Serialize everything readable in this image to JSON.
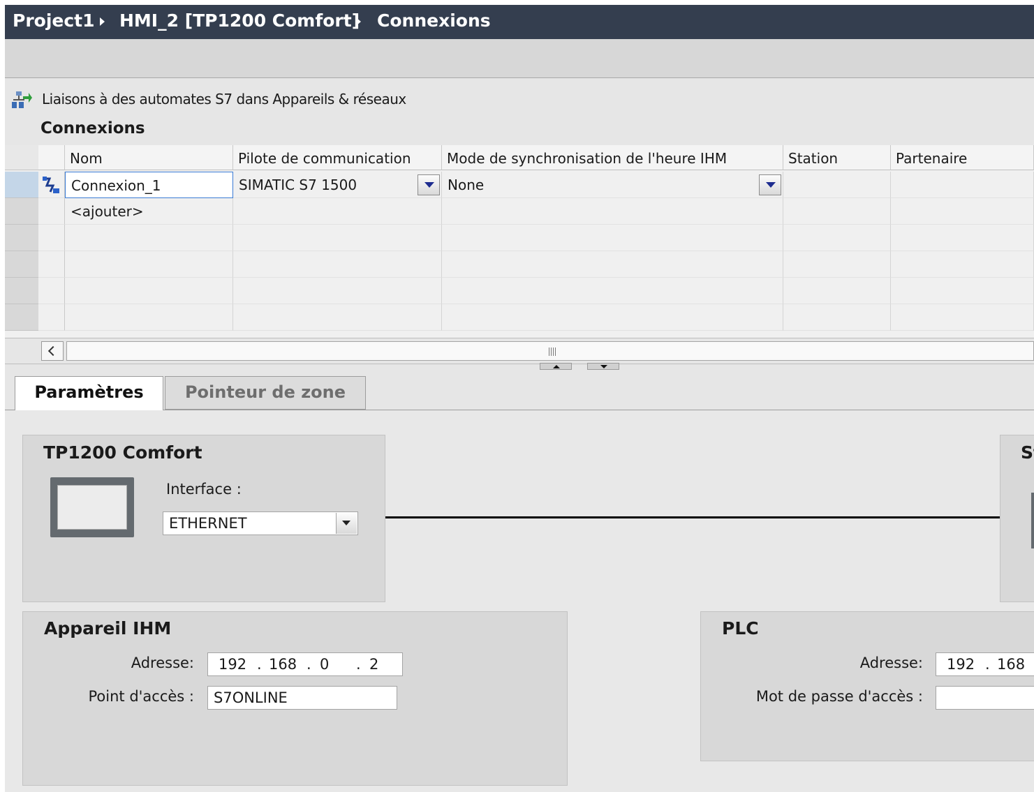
{
  "breadcrumb": {
    "project": "Project1",
    "device": "HMI_2 [TP1200 Comfort]",
    "page": "Connexions"
  },
  "link_row": {
    "icon": "network-devices-icon",
    "label": "Liaisons à des automates S7 dans Appareils & réseaux"
  },
  "connections_title": "Connexions",
  "table": {
    "columns": [
      "Nom",
      "Pilote de communication",
      "Mode de synchronisation de l'heure IHM",
      "Station",
      "Partenaire"
    ],
    "rows": [
      {
        "icon": "connection-icon",
        "name": "Connexion_1",
        "driver": "SIMATIC S7 1500",
        "sync_mode": "None",
        "station": "",
        "partner": ""
      }
    ],
    "add_row": "<ajouter>"
  },
  "tabs": {
    "parameters": "Paramètres",
    "area_pointer": "Pointeur de zone"
  },
  "hmi_panel": {
    "title": "TP1200 Comfort",
    "interface_label": "Interface :",
    "interface_value": "ETHERNET"
  },
  "partner_panel": {
    "title_partial": "St"
  },
  "hmi_device": {
    "title": "Appareil IHM",
    "address_label": "Adresse:",
    "address": [
      "192",
      "168",
      "0",
      "2"
    ],
    "access_point_label": "Point d'accès :",
    "access_point": "S7ONLINE"
  },
  "plc": {
    "title": "PLC",
    "address_label": "Adresse:",
    "address_visible": [
      "192",
      "168"
    ],
    "password_label": "Mot de passe d'accès :",
    "password": ""
  }
}
